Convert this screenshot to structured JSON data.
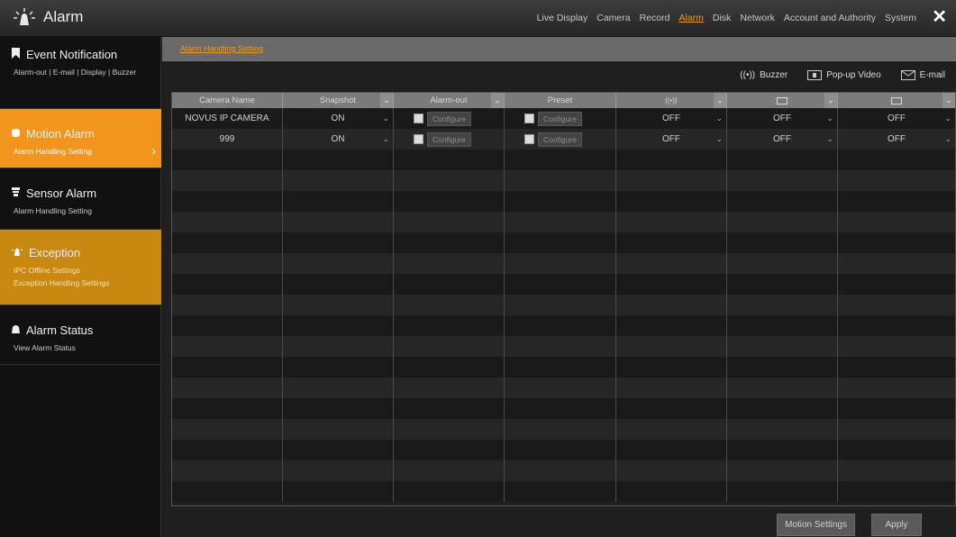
{
  "app": {
    "title": "Alarm"
  },
  "topnav": [
    "Live Display",
    "Camera",
    "Record",
    "Alarm",
    "Disk",
    "Network",
    "Account and Authority",
    "System"
  ],
  "topnav_active": "Alarm",
  "close": "✕",
  "sidebar": {
    "event": {
      "title": "Event Notification",
      "links": "Alarm-out | E-mail | Display | Buzzer"
    },
    "motion": {
      "title": "Motion Alarm",
      "sub": "Alarm Handling Setting"
    },
    "sensor": {
      "title": "Sensor Alarm",
      "sub": "Alarm Handling Setting"
    },
    "exception": {
      "title": "Exception",
      "sub1": "IPC Offline Settings",
      "sub2": "Exception Handling Settings"
    },
    "status": {
      "title": "Alarm Status",
      "sub": "View Alarm Status"
    }
  },
  "subtab": "Alarm Handling Setting",
  "legend": {
    "buzzer": "Buzzer",
    "popup": "Pop-up Video",
    "email": "E-mail"
  },
  "table": {
    "headers": [
      "Camera Name",
      "Snapshot",
      "Alarm-out",
      "Preset",
      "",
      "",
      ""
    ],
    "rows": [
      {
        "name": "NOVUS IP CAMERA",
        "snapshot": "ON",
        "alarm_out": "Configure",
        "preset": "Configure",
        "buzzer": "OFF",
        "popup": "OFF",
        "email": "OFF"
      },
      {
        "name": "999",
        "snapshot": "ON",
        "alarm_out": "Configure",
        "preset": "Configure",
        "buzzer": "OFF",
        "popup": "OFF",
        "email": "OFF"
      }
    ]
  },
  "buttons": {
    "motion_settings": "Motion Settings",
    "apply": "Apply"
  },
  "colors": {
    "accent": "#f2951c",
    "exception": "#c9880f"
  }
}
